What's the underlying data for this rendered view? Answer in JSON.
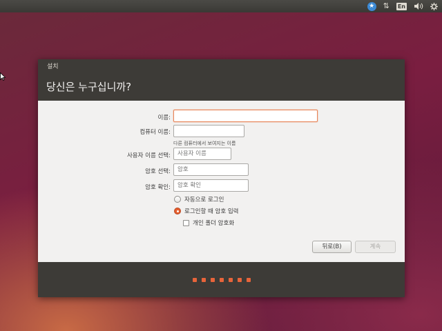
{
  "top_panel": {
    "accessibility_icon": "accessibility-icon",
    "network_icon": "network-updown-icon",
    "language": "En",
    "volume_icon": "volume-icon",
    "settings_icon": "gear-icon"
  },
  "window": {
    "title": "설치",
    "heading": "당신은 누구십니까?"
  },
  "form": {
    "name_label": "이름:",
    "name_value": "",
    "computer_name_label": "컴퓨터 이름:",
    "computer_name_value": "",
    "computer_name_hint": "다른 컴퓨터에서 보여지는 이름",
    "username_label": "사용자 이름 선택:",
    "username_placeholder": "사용자 이름",
    "password_label": "암호 선택:",
    "password_placeholder": "암호",
    "confirm_label": "암호 확인:",
    "confirm_placeholder": "암호 확인",
    "auto_login_label": "자동으로 로그인",
    "require_password_label": "로그인할 때 암호 입력",
    "encrypt_home_label": "개인 폴더 암호화",
    "selected_login_option": "require_password"
  },
  "buttons": {
    "back": "뒤로(B)",
    "continue": "계속"
  },
  "progress": {
    "total_steps": 7,
    "accent": "#e8643a"
  }
}
